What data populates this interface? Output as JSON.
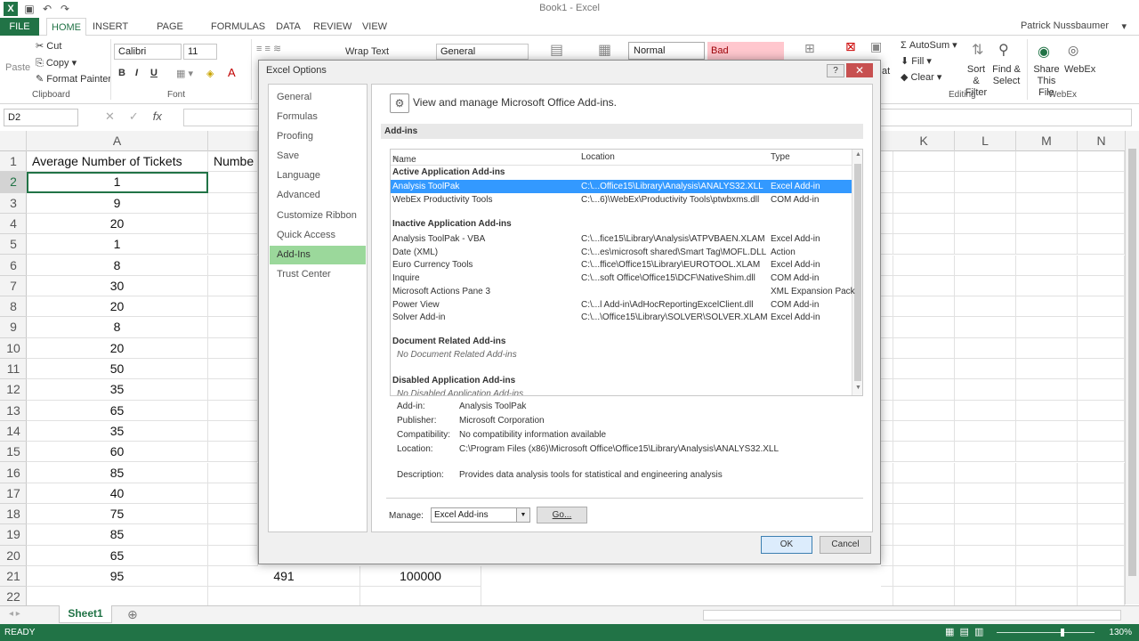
{
  "window": {
    "title": "Book1 - Excel",
    "user": "Patrick Nussbaumer"
  },
  "ribbon_tabs": [
    "FILE",
    "HOME",
    "INSERT",
    "PAGE LAYOUT",
    "FORMULAS",
    "DATA",
    "REVIEW",
    "VIEW"
  ],
  "ribbon": {
    "cut": "Cut",
    "copy": "Copy",
    "format_painter": "Format Painter",
    "paste": "Paste",
    "clipboard": "Clipboard",
    "font_name": "Calibri",
    "font_size": "11",
    "bold": "B",
    "italic": "I",
    "underline": "U",
    "font_group": "Font",
    "wrap_text": "Wrap Text",
    "number_format": "General",
    "style_normal": "Normal",
    "style_bad": "Bad",
    "autosum": "AutoSum",
    "fill": "Fill",
    "clear": "Clear",
    "sort_filter": "Sort & Filter",
    "find_select": "Find & Select",
    "editing": "Editing",
    "share_this_file": "Share This File",
    "webex": "WebEx",
    "webex_group": "WebEx",
    "at_fragment": "at"
  },
  "formula_bar": {
    "name_box": "D2",
    "fx": "fx"
  },
  "grid": {
    "columns_left": [
      "A"
    ],
    "col_b_header_partial": "Numbe",
    "columns_right": [
      "K",
      "L",
      "M",
      "N"
    ],
    "rows": [
      "1",
      "2",
      "3",
      "4",
      "5",
      "6",
      "7",
      "8",
      "9",
      "10",
      "11",
      "12",
      "13",
      "14",
      "15",
      "16",
      "17",
      "18",
      "19",
      "20",
      "21",
      "22"
    ],
    "header_a1": "Average Number of Tickets",
    "values_a": [
      "1",
      "9",
      "20",
      "1",
      "8",
      "30",
      "20",
      "8",
      "20",
      "50",
      "35",
      "65",
      "35",
      "60",
      "85",
      "40",
      "75",
      "85",
      "65",
      "95"
    ],
    "row21_b": "491",
    "row21_c": "100000"
  },
  "sheets": [
    "Sheet1"
  ],
  "status": {
    "ready": "READY",
    "zoom": "130%"
  },
  "dialog": {
    "title": "Excel Options",
    "help": "?",
    "close": "✕",
    "nav": [
      "General",
      "Formulas",
      "Proofing",
      "Save",
      "Language",
      "Advanced",
      "Customize Ribbon",
      "Quick Access Toolbar",
      "Add-Ins",
      "Trust Center"
    ],
    "header": "View and manage Microsoft Office Add-ins.",
    "section": "Add-ins",
    "list_headers": {
      "name": "Name",
      "location": "Location",
      "type": "Type"
    },
    "groups": {
      "active": "Active Application Add-ins",
      "inactive": "Inactive Application Add-ins",
      "document": "Document Related Add-ins",
      "disabled": "Disabled Application Add-ins"
    },
    "active_rows": [
      {
        "name": "Analysis ToolPak",
        "location": "C:\\...Office15\\Library\\Analysis\\ANALYS32.XLL",
        "type": "Excel Add-in"
      },
      {
        "name": "WebEx Productivity Tools",
        "location": "C:\\...6)\\WebEx\\Productivity Tools\\ptwbxms.dll",
        "type": "COM Add-in"
      }
    ],
    "inactive_rows": [
      {
        "name": "Analysis ToolPak - VBA",
        "location": "C:\\...fice15\\Library\\Analysis\\ATPVBAEN.XLAM",
        "type": "Excel Add-in"
      },
      {
        "name": "Date (XML)",
        "location": "C:\\...es\\microsoft shared\\Smart Tag\\MOFL.DLL",
        "type": "Action"
      },
      {
        "name": "Euro Currency Tools",
        "location": "C:\\...ffice\\Office15\\Library\\EUROTOOL.XLAM",
        "type": "Excel Add-in"
      },
      {
        "name": "Inquire",
        "location": "C:\\...soft Office\\Office15\\DCF\\NativeShim.dll",
        "type": "COM Add-in"
      },
      {
        "name": "Microsoft Actions Pane 3",
        "location": "",
        "type": "XML Expansion Pack"
      },
      {
        "name": "Power View",
        "location": "C:\\...l Add-in\\AdHocReportingExcelClient.dll",
        "type": "COM Add-in"
      },
      {
        "name": "Solver Add-in",
        "location": "C:\\...\\Office15\\Library\\SOLVER\\SOLVER.XLAM",
        "type": "Excel Add-in"
      }
    ],
    "no_document": "No Document Related Add-ins",
    "no_disabled": "No Disabled Application Add-ins",
    "details": {
      "addin_label": "Add-in:",
      "addin": "Analysis ToolPak",
      "publisher_label": "Publisher:",
      "publisher": "Microsoft Corporation",
      "compat_label": "Compatibility:",
      "compat": "No compatibility information available",
      "location_label": "Location:",
      "location": "C:\\Program Files (x86)\\Microsoft Office\\Office15\\Library\\Analysis\\ANALYS32.XLL",
      "desc_label": "Description:",
      "desc": "Provides data analysis tools for statistical and engineering analysis"
    },
    "manage_label": "Manage:",
    "manage_value": "Excel Add-ins",
    "go": "Go...",
    "ok": "OK",
    "cancel": "Cancel"
  }
}
